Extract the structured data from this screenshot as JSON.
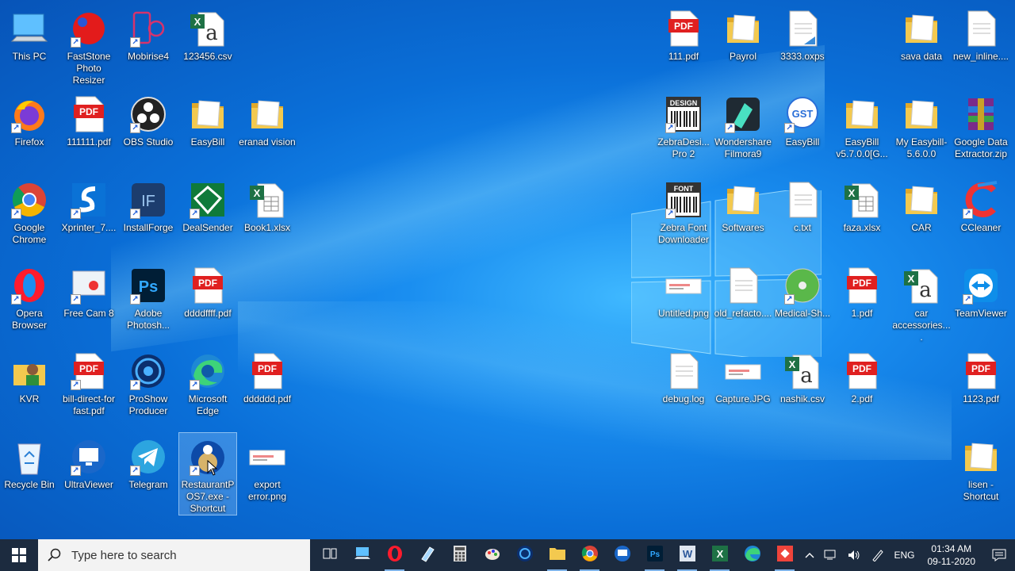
{
  "desktop": {
    "icons": [
      {
        "label": "This PC",
        "icon": "this-pc-icon"
      },
      {
        "label": "FastStone Photo Resizer",
        "icon": "faststone-icon"
      },
      {
        "label": "Mobirise4",
        "icon": "mobirise-icon"
      },
      {
        "label": "123456.csv",
        "icon": "excel-csv-icon"
      },
      {
        "label": "Firefox",
        "icon": "firefox-icon"
      },
      {
        "label": "111111.pdf",
        "icon": "pdf-icon"
      },
      {
        "label": "OBS Studio",
        "icon": "obs-icon"
      },
      {
        "label": "EasyBill",
        "icon": "folder-icon"
      },
      {
        "label": "eranad vision",
        "icon": "folder-icon"
      },
      {
        "label": "Google Chrome",
        "icon": "chrome-icon"
      },
      {
        "label": "Xprinter_7....",
        "icon": "xprinter-icon"
      },
      {
        "label": "InstallForge",
        "icon": "installforge-icon"
      },
      {
        "label": "DealSender",
        "icon": "dealsender-icon"
      },
      {
        "label": "Book1.xlsx",
        "icon": "excel-icon"
      },
      {
        "label": "Opera Browser",
        "icon": "opera-icon"
      },
      {
        "label": "Free Cam 8",
        "icon": "freecam-icon"
      },
      {
        "label": "Adobe Photosh...",
        "icon": "photoshop-icon"
      },
      {
        "label": "ddddffff.pdf",
        "icon": "pdf-icon"
      },
      {
        "label": "KVR",
        "icon": "folder-user-icon"
      },
      {
        "label": "bill-direct-for fast.pdf",
        "icon": "pdf-icon"
      },
      {
        "label": "ProShow Producer",
        "icon": "proshow-icon"
      },
      {
        "label": "Microsoft Edge",
        "icon": "edge-icon"
      },
      {
        "label": "dddddd.pdf",
        "icon": "pdf-icon"
      },
      {
        "label": "Recycle Bin",
        "icon": "recycle-bin-icon"
      },
      {
        "label": "UltraViewer",
        "icon": "ultraviewer-icon"
      },
      {
        "label": "Telegram",
        "icon": "telegram-icon"
      },
      {
        "label": "RestaurantPOS7.exe - Shortcut",
        "icon": "restaurantpos-icon"
      },
      {
        "label": "export error.png",
        "icon": "image-icon"
      },
      {
        "label": "111.pdf",
        "icon": "pdf-icon"
      },
      {
        "label": "Payrol",
        "icon": "folder-icon"
      },
      {
        "label": "3333.oxps",
        "icon": "oxps-icon"
      },
      {
        "label": "sava data",
        "icon": "folder-icon"
      },
      {
        "label": "new_inline....",
        "icon": "text-file-icon"
      },
      {
        "label": "ZebraDesi... Pro 2",
        "icon": "zebra-design-icon"
      },
      {
        "label": "Wondershare Filmora9",
        "icon": "filmora-icon"
      },
      {
        "label": "EasyBill",
        "icon": "easybill-gst-icon"
      },
      {
        "label": "EasyBill v5.7.0.0[G...",
        "icon": "folder-icon"
      },
      {
        "label": "My Easybill-5.6.0.0",
        "icon": "folder-icon"
      },
      {
        "label": "Google Data Extractor.zip",
        "icon": "winrar-icon"
      },
      {
        "label": "Zebra Font Downloader",
        "icon": "zebra-font-icon"
      },
      {
        "label": "Softwares",
        "icon": "folder-icon"
      },
      {
        "label": "c.txt",
        "icon": "text-file-icon"
      },
      {
        "label": "faza.xlsx",
        "icon": "excel-icon"
      },
      {
        "label": "CAR",
        "icon": "folder-icon"
      },
      {
        "label": "CCleaner",
        "icon": "ccleaner-icon"
      },
      {
        "label": "Untitled.png",
        "icon": "image-icon"
      },
      {
        "label": "old_refacto....",
        "icon": "text-file-icon"
      },
      {
        "label": "Medical-Sh...",
        "icon": "disc-icon"
      },
      {
        "label": "1.pdf",
        "icon": "pdf-icon"
      },
      {
        "label": "car accessories....",
        "icon": "excel-csv-icon"
      },
      {
        "label": "TeamViewer",
        "icon": "teamviewer-icon"
      },
      {
        "label": "debug.log",
        "icon": "text-file-icon"
      },
      {
        "label": "Capture.JPG",
        "icon": "image-icon"
      },
      {
        "label": "nashik.csv",
        "icon": "excel-csv-icon"
      },
      {
        "label": "2.pdf",
        "icon": "pdf-icon"
      },
      {
        "label": "1123.pdf",
        "icon": "pdf-icon"
      },
      {
        "label": "lisen - Shortcut",
        "icon": "folder-icon"
      }
    ]
  },
  "taskbar": {
    "search_placeholder": "Type here to search",
    "apps": [
      "task-view-icon",
      "this-pc-icon",
      "opera-icon",
      "notepad-icon",
      "calculator-icon",
      "paint-icon",
      "proshow-icon",
      "file-explorer-icon",
      "chrome-icon",
      "ultraviewer-icon",
      "photoshop-icon",
      "word-icon",
      "excel-icon",
      "edge-icon",
      "anydesk-icon"
    ],
    "language": "ENG",
    "time": "01:34 AM",
    "date": "09-11-2020"
  },
  "colors": {
    "pdf": "#e02020",
    "folder": "#f3c94f",
    "excel": "#1e7145",
    "taskbar": "#1c2b3f"
  }
}
